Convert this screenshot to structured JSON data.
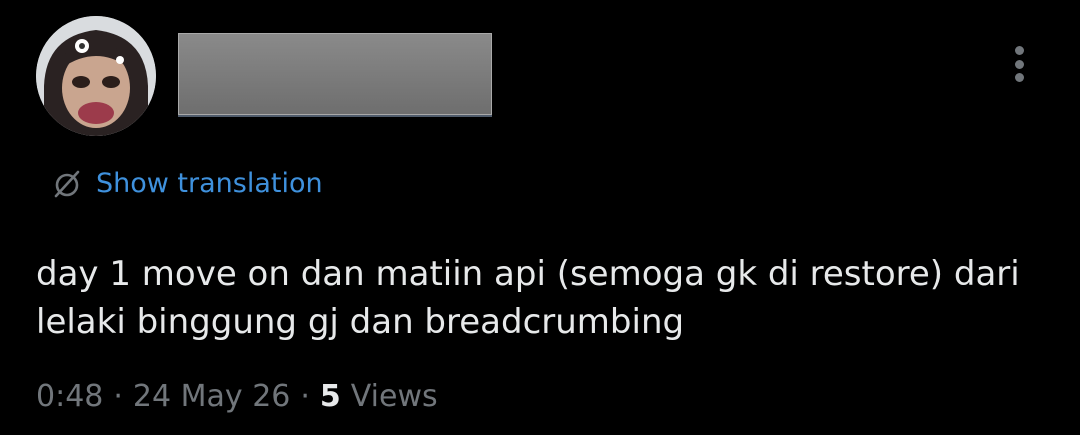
{
  "author": {
    "display_name": ""
  },
  "actions": {
    "more_icon": "more-horizontal-icon"
  },
  "translation": {
    "icon": "globe-icon",
    "label": "Show translation"
  },
  "tweet": {
    "text": "day 1 move on dan matiin api (semoga gk di restore) dari lelaki binggung gj dan breadcrumbing"
  },
  "meta": {
    "time": "0:48",
    "separator": "·",
    "date": "24 May 26",
    "views_count": "5",
    "views_label": "Views"
  },
  "colors": {
    "background": "#000000",
    "text": "#e7e9ea",
    "secondary": "#71767b",
    "link": "#3f91dd"
  }
}
